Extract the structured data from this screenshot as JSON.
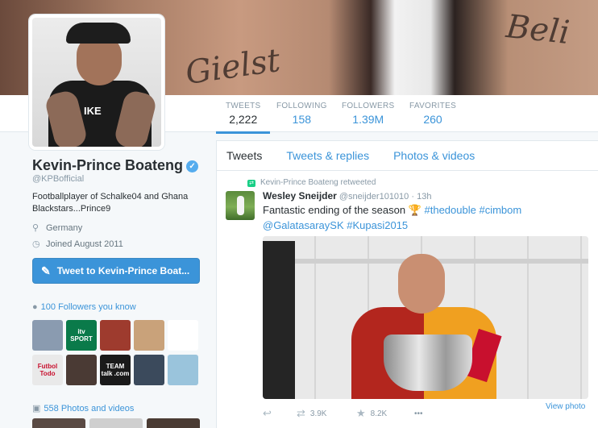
{
  "profile": {
    "name": "Kevin-Prince Boateng",
    "handle": "@KPBofficial",
    "bio": "Footballplayer of Schalke04 and Ghana Blackstars...Prince9",
    "location": "Germany",
    "joined": "Joined August 2011",
    "tweet_to_label": "Tweet to Kevin-Prince Boat...",
    "avatar_shirt_text": "IKE",
    "verified_glyph": "✓"
  },
  "banner": {
    "tattoo_left": "Gielst",
    "tattoo_right": "Beli"
  },
  "stats": [
    {
      "label": "TWEETS",
      "value": "2,222"
    },
    {
      "label": "FOLLOWING",
      "value": "158"
    },
    {
      "label": "FOLLOWERS",
      "value": "1.39M"
    },
    {
      "label": "FAVORITES",
      "value": "260"
    }
  ],
  "followers_you_know": {
    "label": "100 Followers you know",
    "thumbs": [
      {
        "text": "",
        "bg": "#8a9bb0"
      },
      {
        "text": "itv SPORT",
        "bg": "#0a7a4a"
      },
      {
        "text": "",
        "bg": "#9e3b2e"
      },
      {
        "text": "",
        "bg": "#c9a27a"
      },
      {
        "text": "",
        "bg": "#ffffff"
      },
      {
        "text": "Futbol Todo",
        "bg": "#e9e9e9"
      },
      {
        "text": "",
        "bg": "#4a3a34"
      },
      {
        "text": "TEAM talk .com",
        "bg": "#1a1a1a"
      },
      {
        "text": "",
        "bg": "#3b4a5c"
      },
      {
        "text": "",
        "bg": "#9ac4dc"
      }
    ]
  },
  "photos_videos": {
    "label": "558 Photos and videos"
  },
  "timeline": {
    "tabs": [
      "Tweets",
      "Tweets & replies",
      "Photos & videos"
    ],
    "tweet": {
      "retweeted_by": "Kevin-Prince Boateng retweeted",
      "author_name": "Wesley Sneijder",
      "author_handle": "@sneijder101010",
      "time": "· 13h",
      "text_plain": "Fantastic ending of the season ",
      "trophy": "🏆",
      "hashtag1": "#thedouble",
      "hashtag2": "#cimbom",
      "mention": "@GalatasaraySK",
      "hashtag3": "#Kupasi2015",
      "view_photo": "View photo",
      "retweets": "3.9K",
      "favorites": "8.2K",
      "more": "•••"
    }
  },
  "icons": {
    "location": "location-pin-icon",
    "calendar": "calendar-icon",
    "person": "person-icon",
    "camera": "camera-icon",
    "reply": "reply-icon",
    "retweet": "retweet-icon",
    "favorite": "star-icon",
    "more": "more-icon"
  },
  "colors": {
    "link": "#3b94d9",
    "retweet_green": "#19cf86",
    "muted": "#8899a6"
  }
}
